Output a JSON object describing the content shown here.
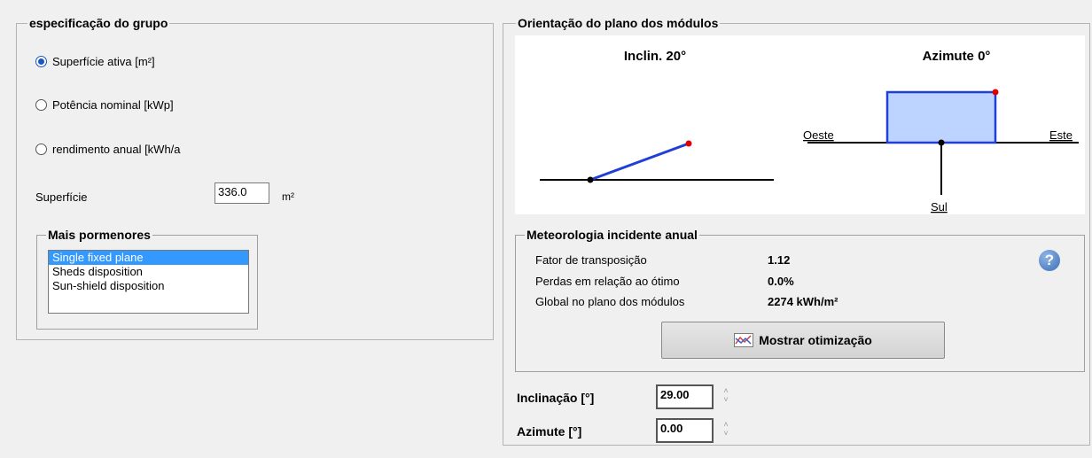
{
  "group_spec": {
    "legend": "especificação do grupo",
    "radios": [
      {
        "label": "Superfície ativa [m²]",
        "selected": true
      },
      {
        "label": "Potência nominal [kWp]",
        "selected": false
      },
      {
        "label": "rendimento anual [kWh/a",
        "selected": false
      }
    ],
    "surface_label": "Superfície",
    "surface_value": "336.0",
    "surface_unit": "m²",
    "details": {
      "legend": "Mais pormenores",
      "options": [
        "Single fixed plane",
        "Sheds disposition",
        "Sun-shield disposition"
      ],
      "selected": "Single fixed plane"
    }
  },
  "orientation": {
    "legend": "Orientação do plano dos módulos",
    "tilt_title": "Inclin. 20°",
    "azimuth_title": "Azimute 0°",
    "west": "Oeste",
    "east": "Este",
    "south": "Sul",
    "plot_colors": {
      "line": "#1f3fd6",
      "fill": "#bcd4ff",
      "dot_end": "#e00000",
      "dot_base": "#000000"
    }
  },
  "meteo": {
    "legend": "Meteorologia incidente anual",
    "rows": [
      {
        "label": "Fator de transposição",
        "value": "1.12"
      },
      {
        "label": "Perdas em relação ao ótimo",
        "value": "0.0%"
      },
      {
        "label": "Global no plano dos módulos",
        "value": "2274 kWh/m²"
      }
    ],
    "button_label": "Mostrar otimização",
    "help_icon": "?"
  },
  "inputs": {
    "tilt_label": "Inclinação [°]",
    "tilt_value": "29.00",
    "azimuth_label": "Azimute [°]",
    "azimuth_value": "0.00"
  }
}
